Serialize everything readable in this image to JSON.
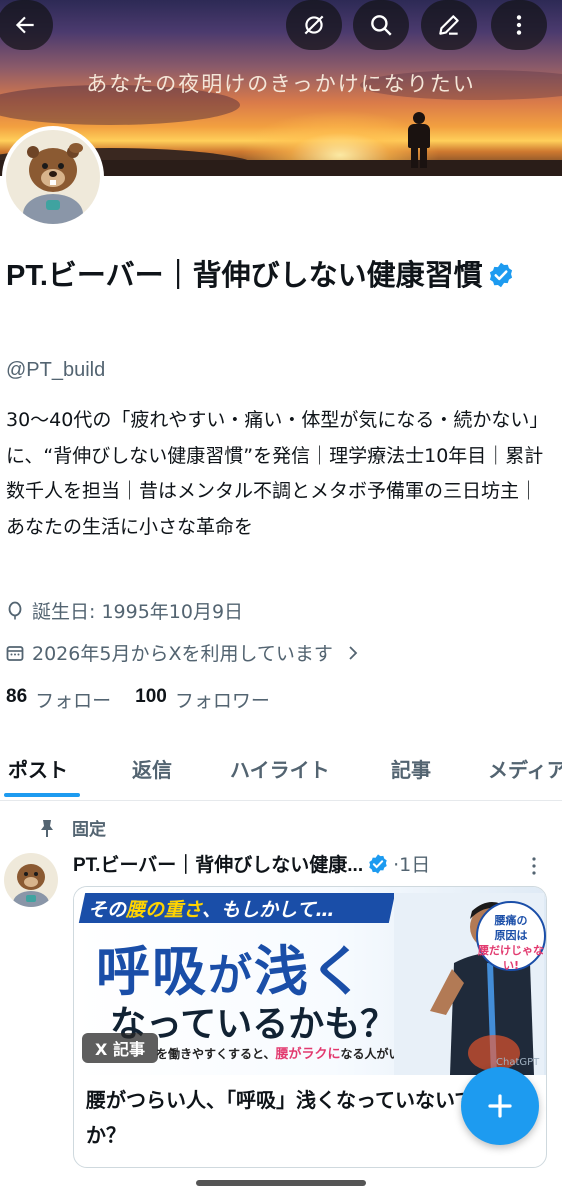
{
  "banner": {
    "tagline": "あなたの夜明けのきっかけになりたい"
  },
  "topbar": {
    "back_icon": "arrow-left-icon",
    "grok_icon": "grok-icon",
    "search_icon": "search-icon",
    "edit_icon": "edit-icon",
    "more_icon": "more-vertical-icon"
  },
  "profile": {
    "name": "PT.ビーバー｜背伸びしない健康習慣",
    "verified": true,
    "handle": "@PT_build",
    "bio": "30〜40代の「疲れやすい・痛い・体型が気になる・続かない」に、“背伸びしない健康習慣”を発信｜理学療法士10年目｜累計数千人を担当｜昔はメンタル不調とメタボ予備軍の三日坊主｜あなたの生活に小さな革命を",
    "birthday": "誕生日: 1995年10月9日",
    "joined": "2026年5月からXを利用しています",
    "following_count": "86",
    "following_label": "フォロー",
    "followers_count": "100",
    "followers_label": "フォロワー"
  },
  "tabs": [
    {
      "label": "ポスト",
      "active": true
    },
    {
      "label": "返信",
      "active": false
    },
    {
      "label": "ハイライト",
      "active": false
    },
    {
      "label": "記事",
      "active": false
    },
    {
      "label": "メディア",
      "active": false
    }
  ],
  "post": {
    "pinned_label": "固定",
    "author": "PT.ビーバー｜背伸びしない健康...",
    "time": "·1日",
    "card": {
      "ribbon_prefix": "その",
      "ribbon_highlight": "腰の重さ",
      "ribbon_suffix": "、もしかして…",
      "headline_a": "呼吸",
      "headline_b": "が",
      "headline_c": "浅く",
      "headline_line2": "なっているかも？",
      "subline_prefix": "を働きやすくすると、",
      "subline_highlight": "腰がラクに",
      "subline_suffix": "なる人がいます。",
      "badge_line1": "腰痛の",
      "badge_line2": "原因は",
      "badge_line3": "腰だけじゃない!",
      "tag": "X 記事",
      "watermark": "ChatGPT",
      "title": "腰がつらい人、「呼吸」浅くなっていないですか？"
    }
  },
  "fab_icon": "plus-icon",
  "colors": {
    "accent": "#1d9bf0",
    "text": "#0f1419",
    "muted": "#536471"
  }
}
